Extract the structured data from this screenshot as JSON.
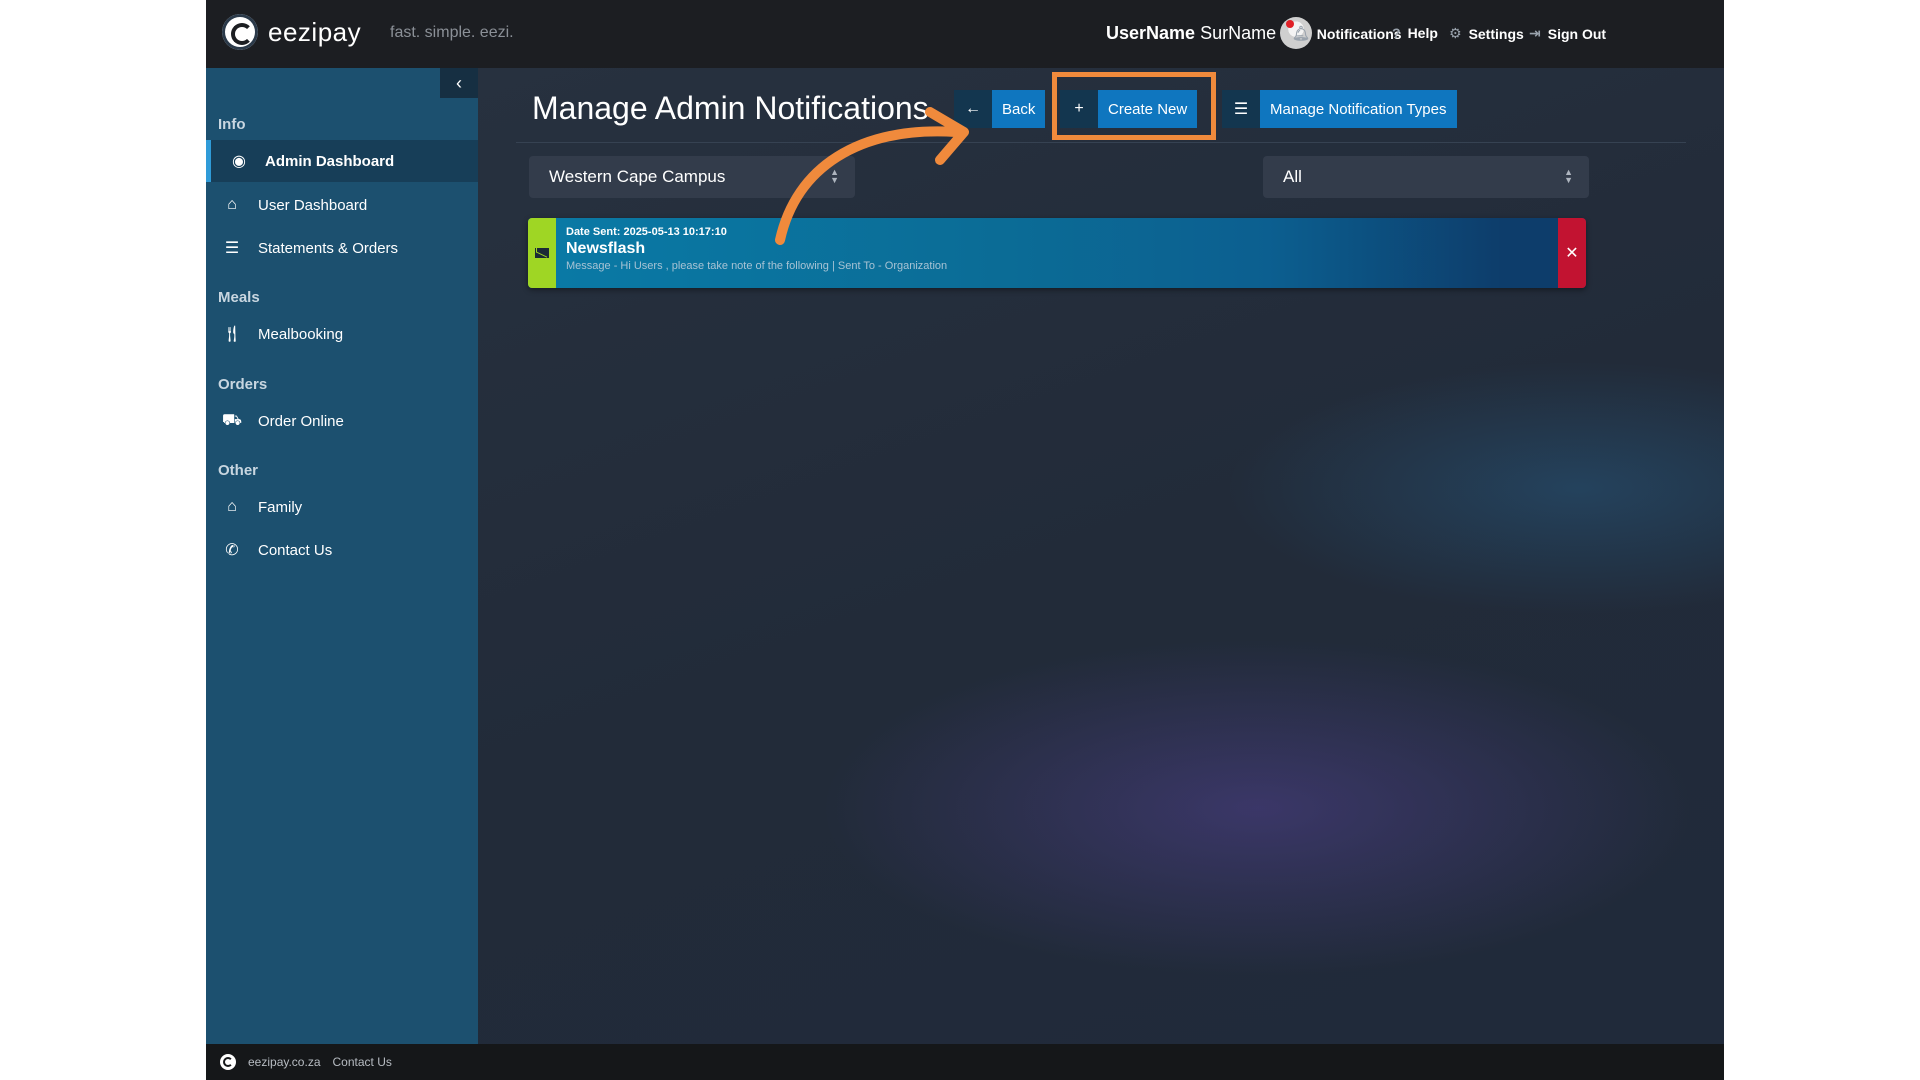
{
  "app": {
    "logo_text": "eezipay",
    "tagline": "fast. simple. eezi."
  },
  "topbar": {
    "user_first": "UserName",
    "user_last": "SurName",
    "notifications": "Notifications",
    "help": "Help",
    "settings": "Settings",
    "sign_out": "Sign Out"
  },
  "sidebar": {
    "collapse_icon": "chevron-left-icon",
    "sections": {
      "info": "Info",
      "meals": "Meals",
      "orders": "Orders",
      "other": "Other"
    },
    "items": [
      {
        "label": "Admin Dashboard",
        "icon": "dashboard-icon"
      },
      {
        "label": "User Dashboard",
        "icon": "home-icon"
      },
      {
        "label": "Statements & Orders",
        "icon": "list-icon"
      },
      {
        "label": "Mealbooking",
        "icon": "cutlery-icon"
      },
      {
        "label": "Order Online",
        "icon": "basket-icon"
      },
      {
        "label": "Family",
        "icon": "family-icon"
      },
      {
        "label": "Contact Us",
        "icon": "phone-icon"
      }
    ]
  },
  "main": {
    "page_title": "Manage Admin Notifications",
    "buttons": {
      "back": "Back",
      "create_new": "Create New",
      "manage_types": "Manage Notification Types"
    },
    "filters": {
      "campus": "Western Cape Campus",
      "type": "All"
    },
    "notification": {
      "date": "Date Sent: 2025-05-13 10:17:10",
      "title": "Newsflash",
      "message": "Message - Hi Users , please take note of the following | Sent To - Organization"
    }
  },
  "footer": {
    "site": "eezipay.co.za",
    "contact": "Contact Us"
  },
  "colors": {
    "accent": "#0f76bf",
    "highlight": "#f08a3c",
    "sidebar": "#1c506f",
    "notif_strip": "#9fd624",
    "close": "#c21331"
  }
}
